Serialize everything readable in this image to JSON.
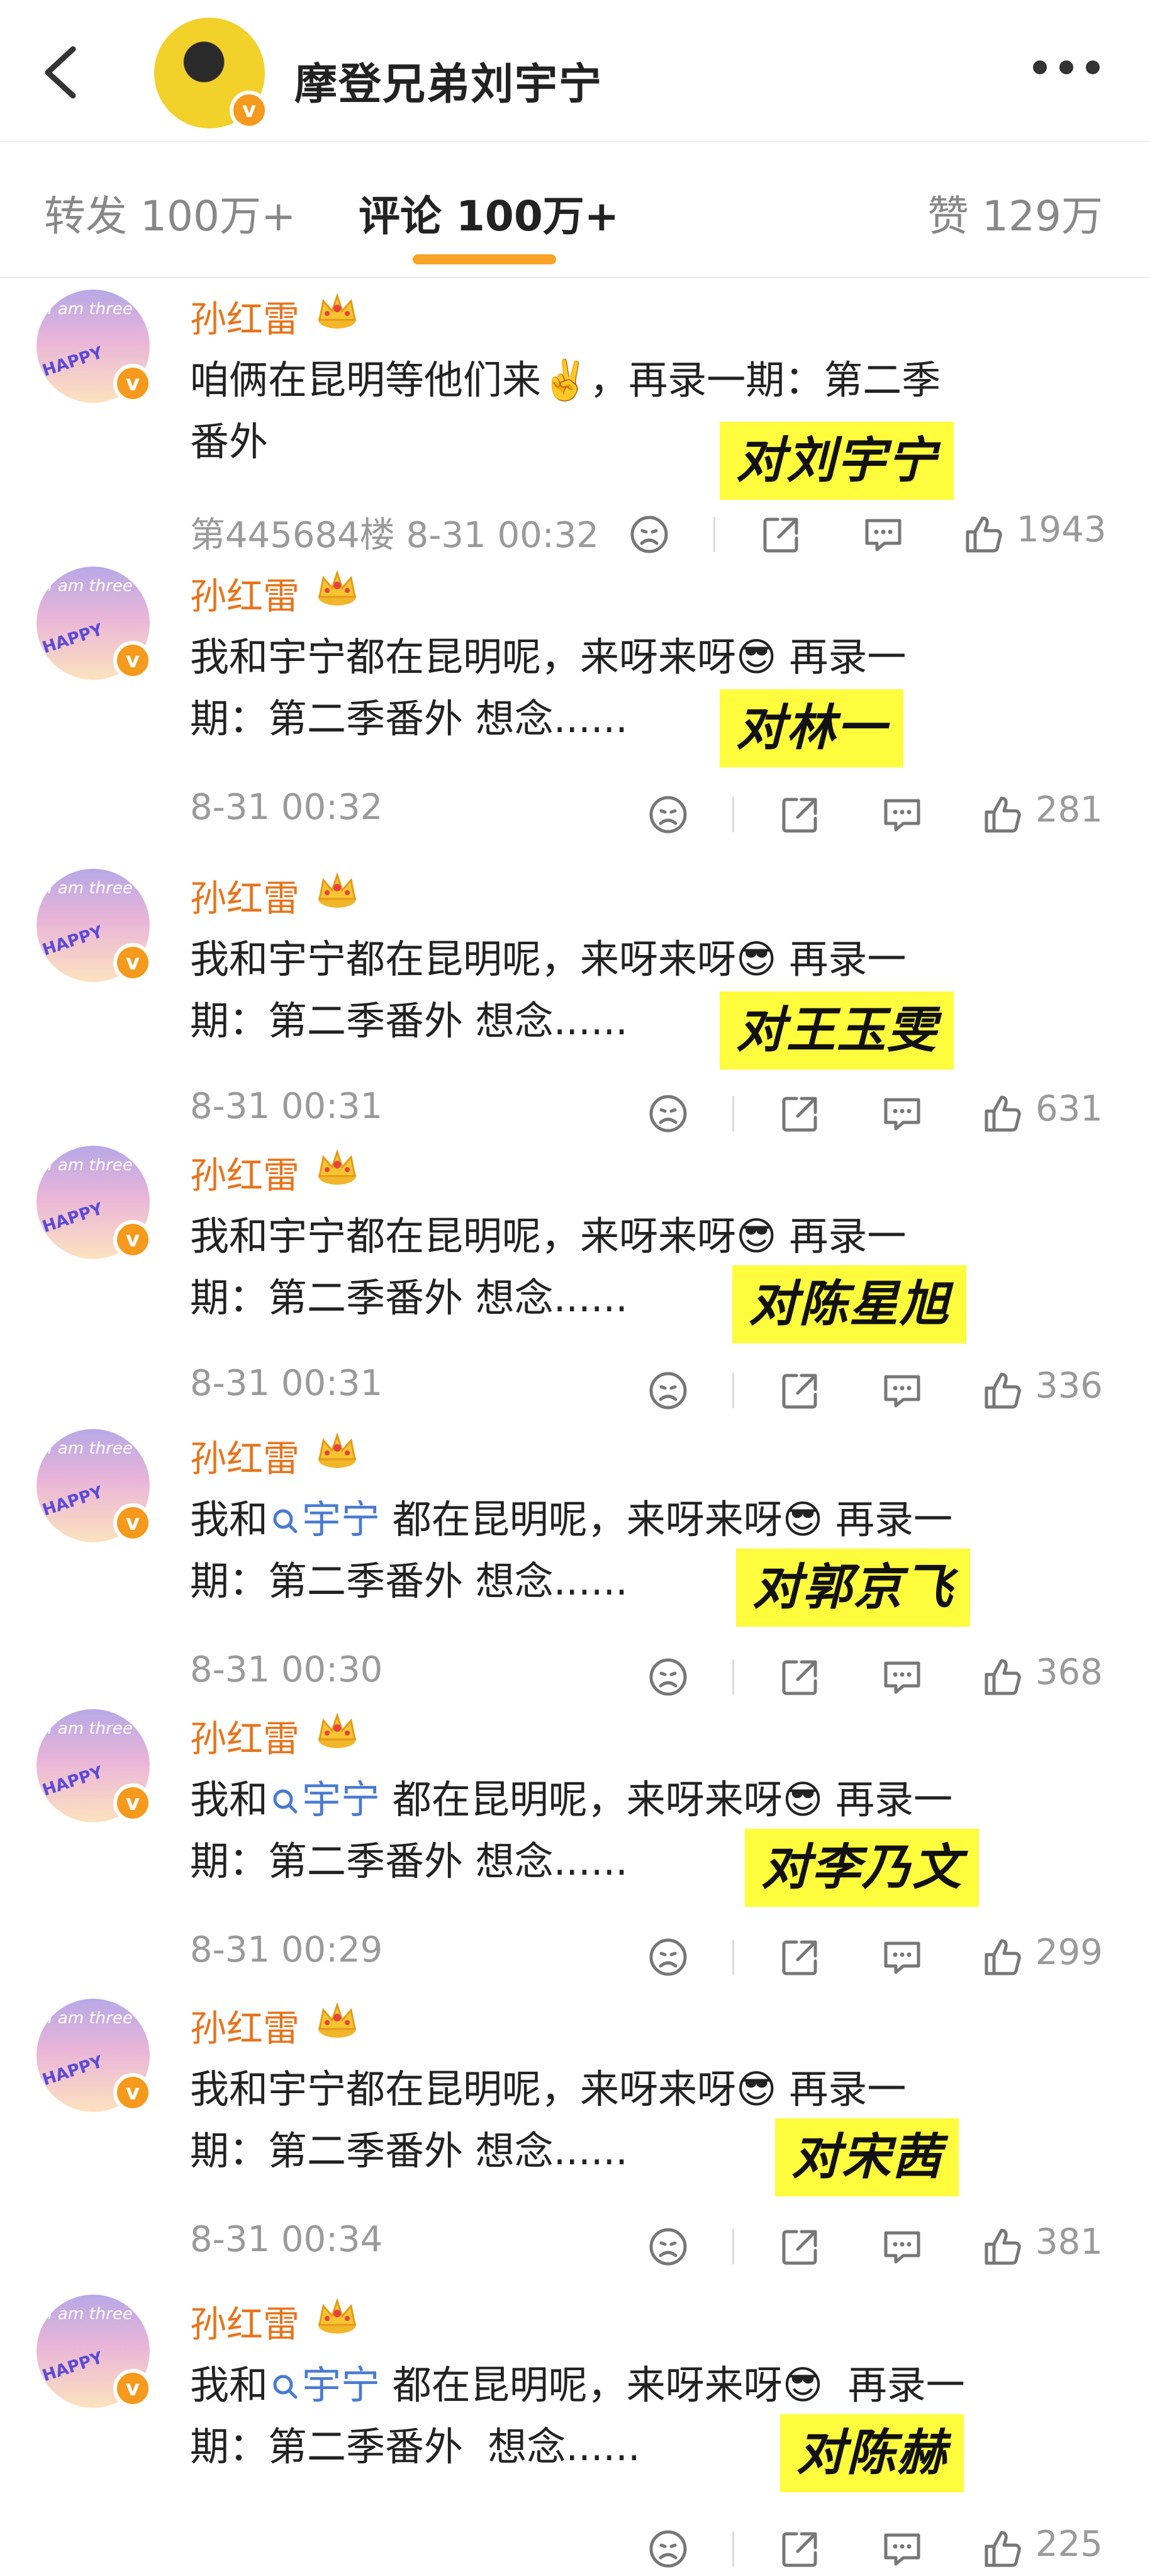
{
  "header": {
    "title": "摩登兄弟刘宇宁"
  },
  "tabs": [
    {
      "label": "转发 100万+"
    },
    {
      "label": "评论 100万+"
    },
    {
      "label": "赞 129万"
    }
  ],
  "comments": [
    {
      "name": "孙红雷",
      "text_a": "咱俩在昆明等他们来✌️，再录一期：第二季",
      "text_b": "番外",
      "label": "对刘宇宁",
      "meta": "第445684楼 8-31 00:32",
      "likes": "1943"
    },
    {
      "name": "孙红雷",
      "text_a": "我和宇宁都在昆明呢，来呀来呀😎 再录一",
      "text_b": "期：第二季番外 想念......",
      "label": "对林一",
      "meta": "8-31 00:32",
      "likes": "281"
    },
    {
      "name": "孙红雷",
      "text_a": "我和宇宁都在昆明呢，来呀来呀😎 再录一",
      "text_b": "期：第二季番外 想念......",
      "label": "对王玉雯",
      "meta": "8-31 00:31",
      "likes": "631"
    },
    {
      "name": "孙红雷",
      "text_a": "我和宇宁都在昆明呢，来呀来呀😎 再录一",
      "text_b": "期：第二季番外 想念......",
      "label": "对陈星旭",
      "meta": "8-31 00:31",
      "likes": "336"
    },
    {
      "name": "孙红雷",
      "text_pre": "我和",
      "mention": "宇宁",
      "text_post": " 都在昆明呢，来呀来呀😎 再录一",
      "text_b": "期：第二季番外 想念......",
      "label": "对郭京飞",
      "meta": "8-31 00:30",
      "likes": "368"
    },
    {
      "name": "孙红雷",
      "text_pre": "我和",
      "mention": "宇宁",
      "text_post": " 都在昆明呢，来呀来呀😎 再录一",
      "text_b": "期：第二季番外 想念......",
      "label": "对李乃文",
      "meta": "8-31 00:29",
      "likes": "299"
    },
    {
      "name": "孙红雷",
      "text_a": "我和宇宁都在昆明呢，来呀来呀😎 再录一",
      "text_b": "期：第二季番外 想念......",
      "label": "对宋茜",
      "meta": "8-31 00:34",
      "likes": "381"
    },
    {
      "name": "孙红雷",
      "text_pre": "我和",
      "mention": "宇宁",
      "text_post": " 都在昆明呢，来呀来呀😎  再录一",
      "text_b": "期：第二季番外  想念......",
      "label": "对陈赫",
      "meta": "",
      "likes": "225"
    }
  ],
  "avatar_text": {
    "line1": "I am three",
    "line2": "HAPPY"
  },
  "colors": {
    "accent": "#f8a326",
    "name": "#e8741c",
    "label_bg": "#fffb3d",
    "mention": "#4a7bd2"
  }
}
